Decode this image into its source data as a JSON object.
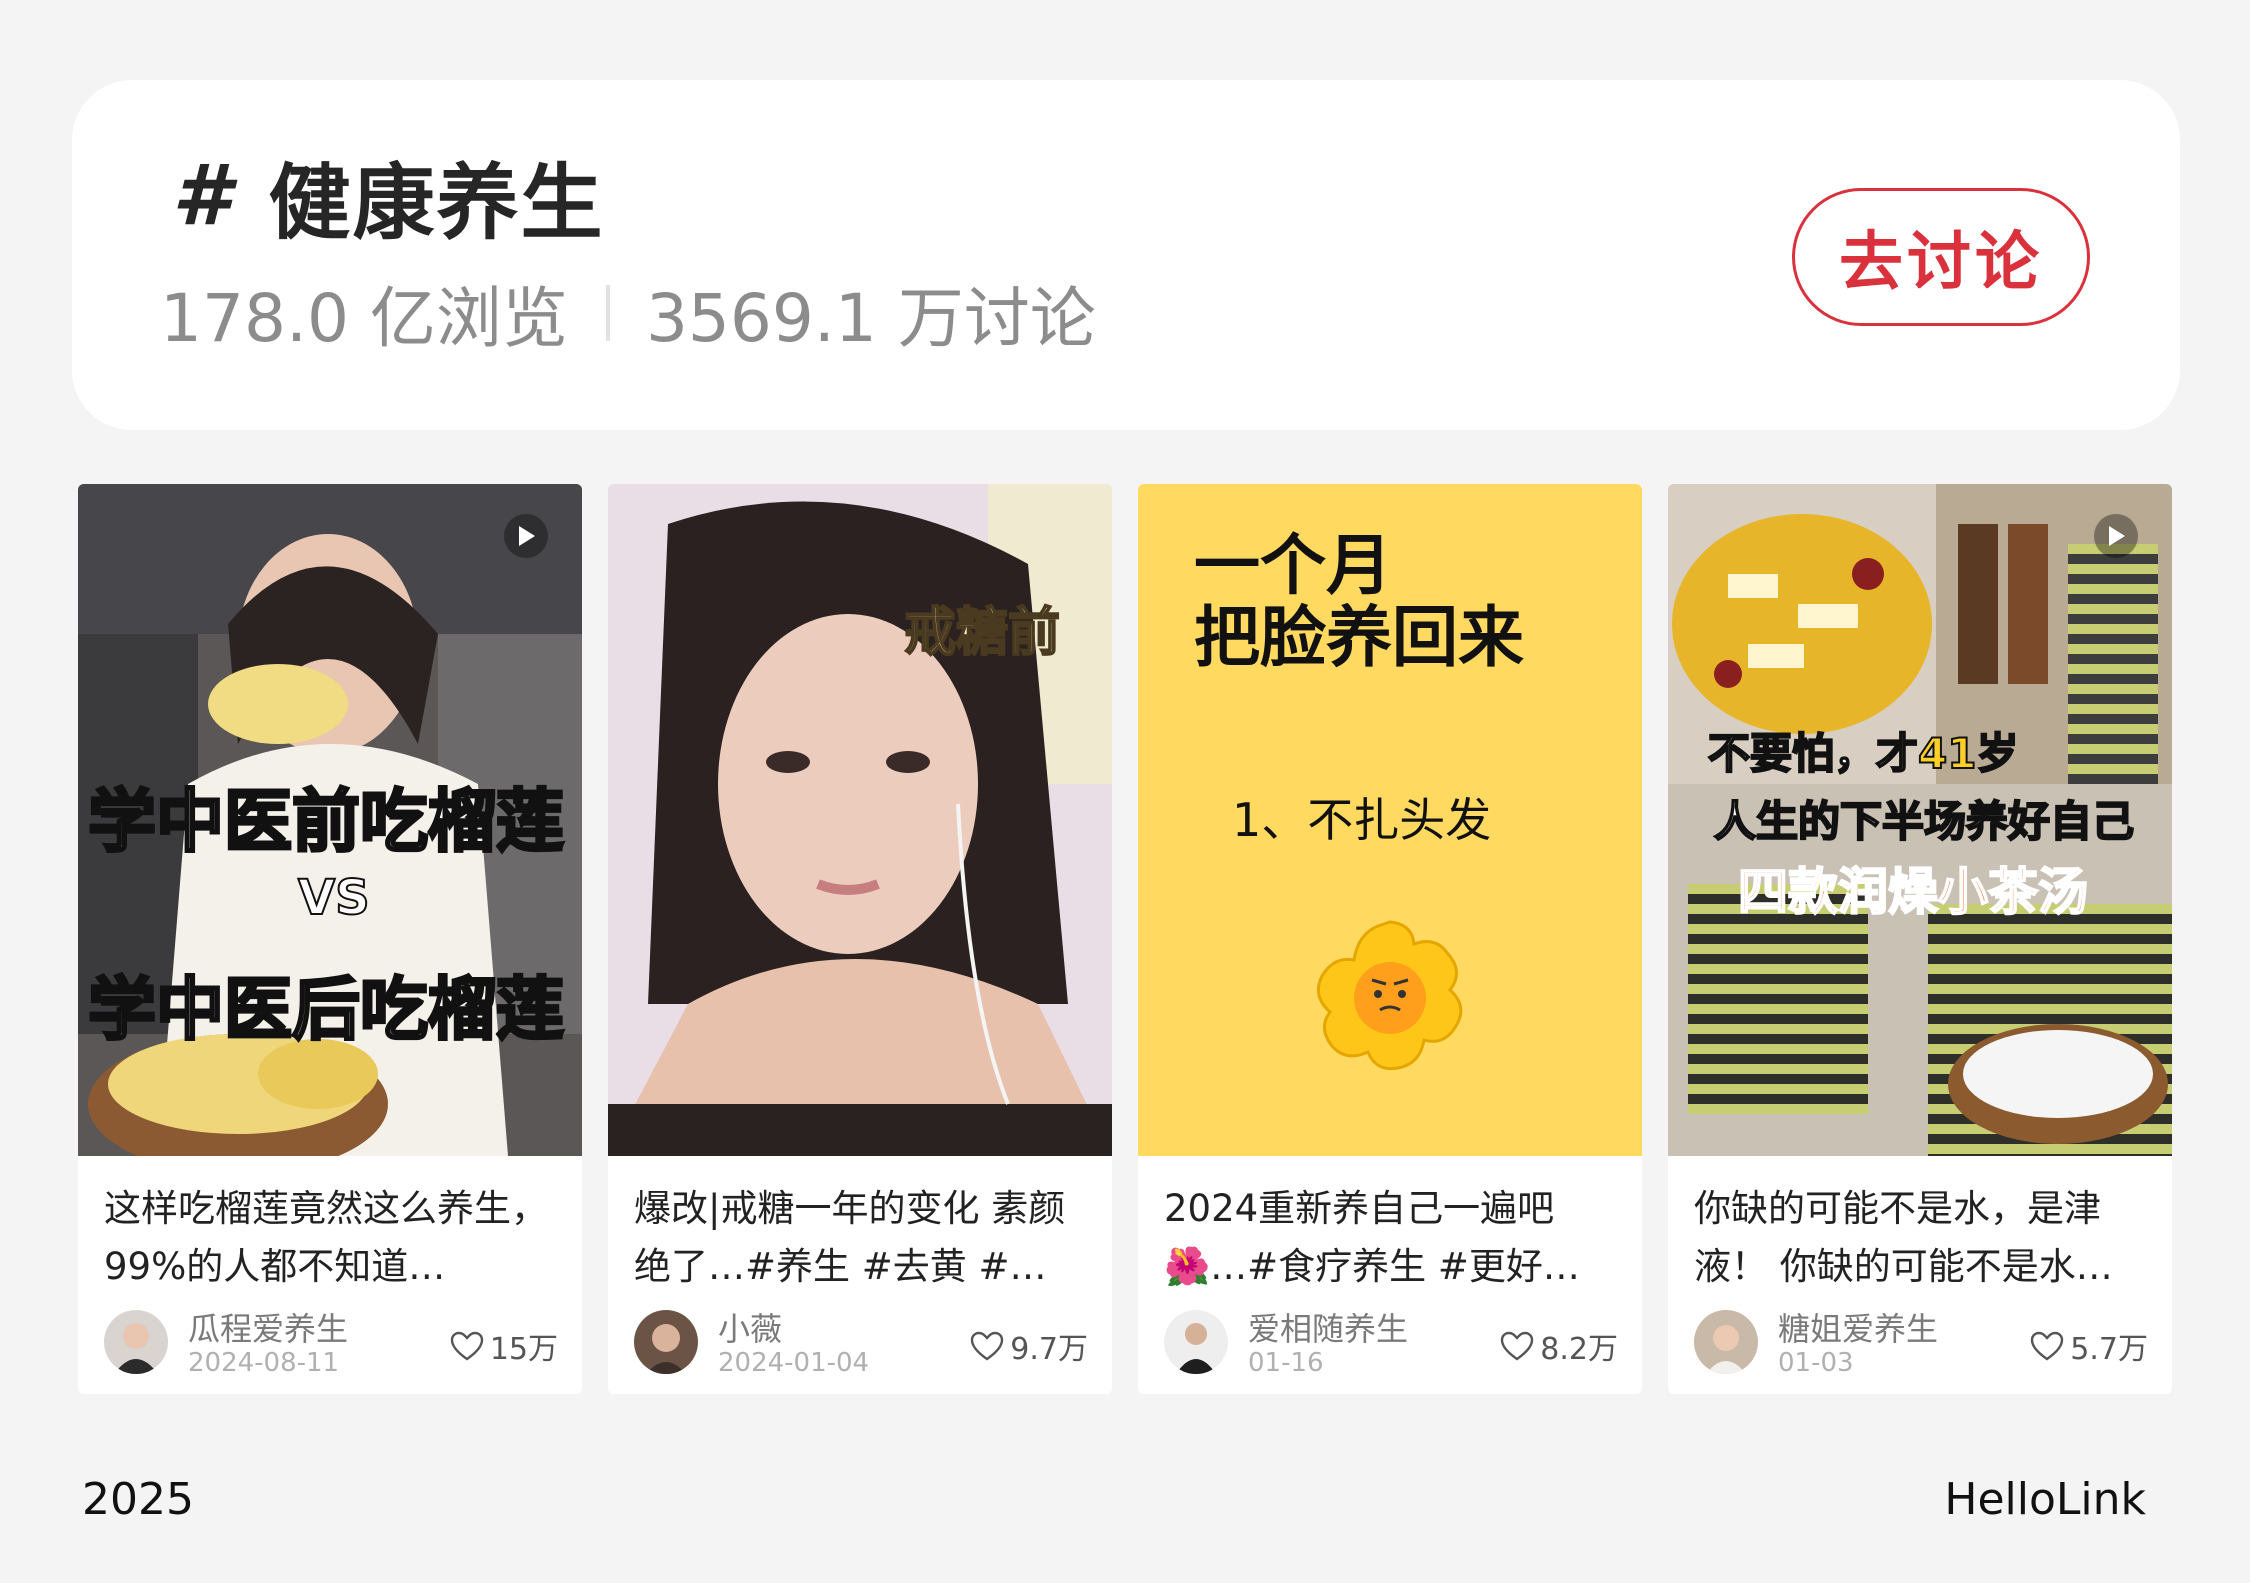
{
  "topic": {
    "hash_symbol": "#",
    "title": "健康养生",
    "views": "178.0 亿浏览",
    "discussions": "3569.1 万讨论",
    "discuss_button_label": "去讨论"
  },
  "colors": {
    "accent": "#d9323d",
    "background": "#f4f4f5",
    "card": "#ffffff"
  },
  "cards": [
    {
      "title": "这样吃榴莲竟然这么养生，99%的人都不知道…",
      "author": "瓜程爱养生",
      "date": "2024-08-11",
      "likes": "15万",
      "is_video": true,
      "cover_text": [
        "学中医前吃榴莲",
        "VS",
        "学中医后吃榴莲"
      ]
    },
    {
      "title": "爆改|戒糖一年的变化 素颜绝了…#养生 #去黄 #…",
      "author": "小薇",
      "date": "2024-01-04",
      "likes": "9.7万",
      "is_video": false,
      "cover_text": [
        "戒糖前"
      ]
    },
    {
      "title": "2024重新养自己一遍吧🌺…#食疗养生 #更好…",
      "author": "爱相随养生",
      "date": "01-16",
      "likes": "8.2万",
      "is_video": false,
      "cover_text": [
        "一个月",
        "把脸养回来",
        "1、不扎头发"
      ]
    },
    {
      "title": "你缺的可能不是水，是津液！ 你缺的可能不是水…",
      "author": "糖姐爱养生",
      "date": "01-03",
      "likes": "5.7万",
      "is_video": true,
      "cover_text": [
        "不要怕，",
        "才41岁",
        "人生的下半场养好自己",
        "四款润燥小茶汤"
      ]
    }
  ],
  "footer": {
    "year": "2025",
    "brand": "HelloLink"
  }
}
